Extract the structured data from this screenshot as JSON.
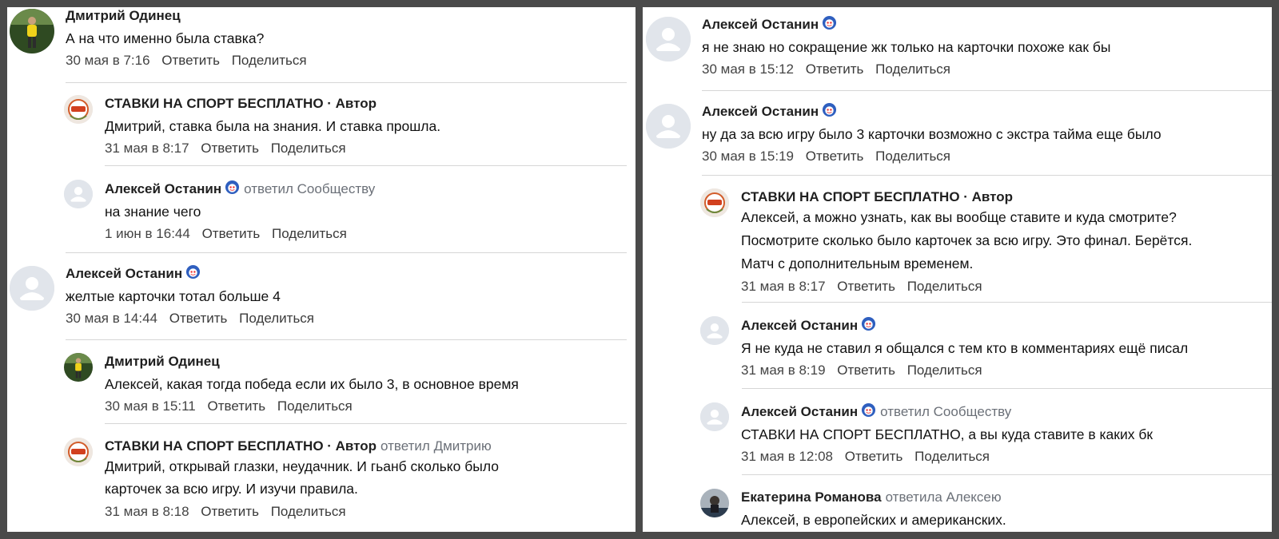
{
  "left": {
    "comments": [
      {
        "author": "Дмитрий Одинец",
        "text": "А на что именно была ставка?",
        "date": "30 мая в 7:16",
        "reply": "Ответить",
        "share": "Поделиться"
      },
      {
        "author": "СТАВКИ НА СПОРТ БЕСПЛАТНО · Автор",
        "text": "Дмитрий, ставка была на знания. И ставка прошла.",
        "date": "31 мая в 8:17",
        "reply": "Ответить",
        "share": "Поделиться"
      },
      {
        "author": "Алексей Останин",
        "replied": "ответил Сообществу",
        "text": "на знание чего",
        "date": "1 июн в 16:44",
        "reply": "Ответить",
        "share": "Поделиться"
      },
      {
        "author": "Алексей Останин",
        "text": "желтые карточки тотал больше 4",
        "date": "30 мая в 14:44",
        "reply": "Ответить",
        "share": "Поделиться"
      },
      {
        "author": "Дмитрий Одинец",
        "text": "Алексей, какая тогда победа если их было 3, в основное время",
        "date": "30 мая в 15:11",
        "reply": "Ответить",
        "share": "Поделиться"
      },
      {
        "author": "СТАВКИ НА СПОРТ БЕСПЛАТНО · Автор",
        "replied": "ответил Дмитрию",
        "text1": "Дмитрий, открывай глазки, неудачник. И гьанб сколько было",
        "text2": "карточек за всю игру. И изучи правила.",
        "date": "31 мая в 8:18",
        "reply": "Ответить",
        "share": "Поделиться"
      }
    ]
  },
  "right": {
    "comments": [
      {
        "author": "Алексей Останин",
        "text": "я не знаю но сокращение жк только на карточки похоже как бы",
        "date": "30 мая в 15:12",
        "reply": "Ответить",
        "share": "Поделиться"
      },
      {
        "author": "Алексей Останин",
        "text": "ну да за всю игру было 3 карточки возможно с экстра тайма еще было",
        "date": "30 мая в 15:19",
        "reply": "Ответить",
        "share": "Поделиться"
      },
      {
        "author": "СТАВКИ НА СПОРТ БЕСПЛАТНО · Автор",
        "text1": "Алексей, а можно узнать, как вы вообще ставите и куда смотрите?",
        "text2": "Посмотрите сколько было карточек за всю игру. Это финал. Берётся.",
        "text3": "Матч с дополнительным временем.",
        "date": "31 мая в 8:17",
        "reply": "Ответить",
        "share": "Поделиться"
      },
      {
        "author": "Алексей Останин",
        "text": "Я не куда не ставил я общался с тем кто в комментариях ещё писал",
        "date": "31 мая в 8:19",
        "reply": "Ответить",
        "share": "Поделиться"
      },
      {
        "author": "Алексей Останин",
        "replied": "ответил Сообществу",
        "text": "СТАВКИ НА СПОРТ БЕСПЛАТНО, а вы куда ставите в каких бк",
        "date": "31 мая в 12:08",
        "reply": "Ответить",
        "share": "Поделиться"
      },
      {
        "author": "Екатерина Романова",
        "replied": "ответила Алексею",
        "text": "Алексей, в европейских и американских."
      }
    ]
  }
}
